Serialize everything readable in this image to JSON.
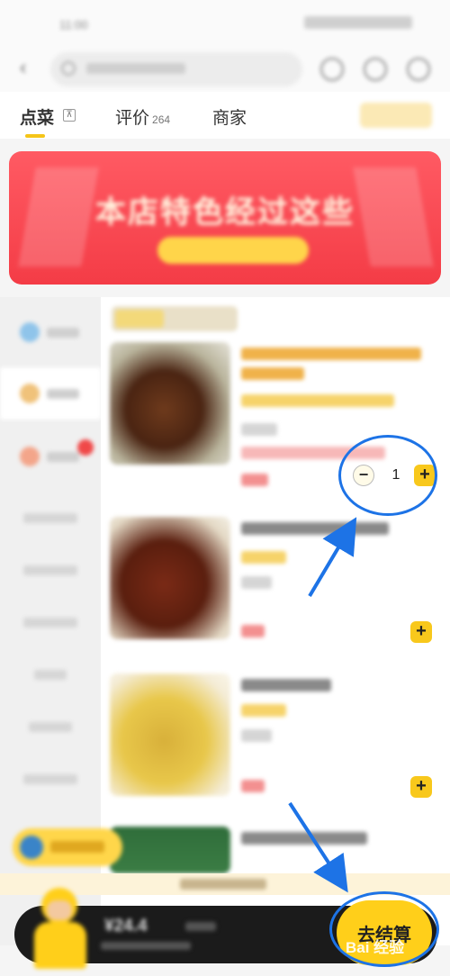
{
  "tabs": [
    {
      "label": "点菜",
      "sub": ""
    },
    {
      "label": "评价",
      "sub": "264"
    },
    {
      "label": "商家",
      "sub": ""
    }
  ],
  "banner": {
    "title": "本店特色经过这些"
  },
  "cart_item": {
    "quantity": "1",
    "minus_label": "−",
    "plus_label": "+"
  },
  "add_label": "+",
  "cart": {
    "amount": "¥24.4",
    "checkout_label": "去结算"
  },
  "watermark": "Bai 经验",
  "colors": {
    "accent": "#f8c81c",
    "annotation": "#1d73e6",
    "banner": "#f43c46"
  }
}
